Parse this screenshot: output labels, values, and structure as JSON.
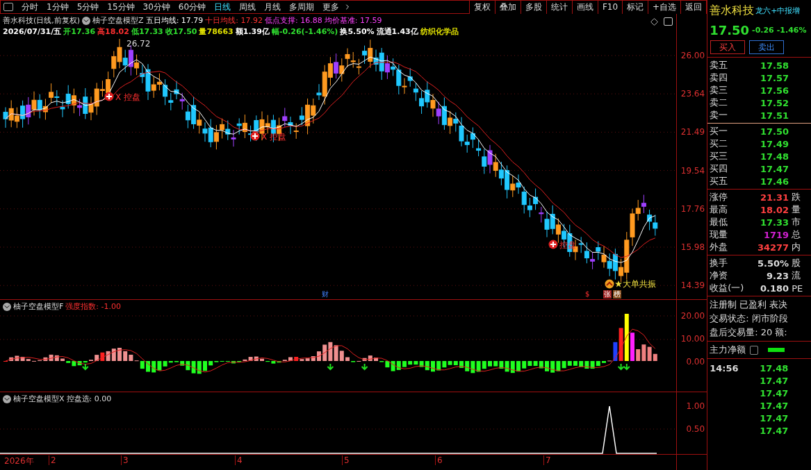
{
  "toolbar": {
    "periods": [
      {
        "label": "分时",
        "selected": false
      },
      {
        "label": "1分钟",
        "selected": false
      },
      {
        "label": "5分钟",
        "selected": false
      },
      {
        "label": "15分钟",
        "selected": false
      },
      {
        "label": "30分钟",
        "selected": false
      },
      {
        "label": "60分钟",
        "selected": false
      },
      {
        "label": "日线",
        "selected": true
      },
      {
        "label": "周线",
        "selected": false
      },
      {
        "label": "月线",
        "selected": false
      },
      {
        "label": "多周期",
        "selected": false
      },
      {
        "label": "更多",
        "selected": false
      }
    ],
    "actions": [
      "复权",
      "叠加",
      "多股",
      "统计",
      "画线",
      "F10",
      "标记",
      "+自选",
      "返回"
    ]
  },
  "main_chart": {
    "title": "善水科技(日线,前复权)",
    "indicator": "柚子空盘模型Z",
    "legend": [
      {
        "text": "五日均线: 17.79",
        "color": "#ffffff"
      },
      {
        "text": "十日均线: 17.92",
        "color": "#ff3030"
      },
      {
        "text": "低点支撑: 16.88",
        "color": "#ff40ff"
      },
      {
        "text": "均价基准: 17.59",
        "color": "#ff40ff"
      }
    ],
    "quote": [
      {
        "text": "2026/07/31/五",
        "color": "#ffffff"
      },
      {
        "text": "开17.36",
        "color": "#30e030"
      },
      {
        "text": "高18.02",
        "color": "#ff3030"
      },
      {
        "text": "低17.33",
        "color": "#30e030"
      },
      {
        "text": "收17.50",
        "color": "#30e030"
      },
      {
        "text": "量78663",
        "color": "#e0e000"
      },
      {
        "text": "额1.39亿",
        "color": "#ffffff"
      },
      {
        "text": "幅-0.26(-1.46%)",
        "color": "#30e030"
      },
      {
        "text": "换5.50%",
        "color": "#ffffff"
      },
      {
        "text": "流通1.43亿",
        "color": "#ffffff"
      },
      {
        "text": "纺织化学品",
        "color": "#e0e000"
      }
    ],
    "price_axis": [
      "26.00",
      "23.64",
      "21.49",
      "19.54",
      "17.76",
      "15.98",
      "14.39"
    ],
    "peak_label": "26.72",
    "markers": [
      {
        "kind": "control",
        "text": "X 控盘"
      },
      {
        "kind": "control",
        "text": "X 控盘"
      },
      {
        "kind": "control",
        "text": "控盘"
      }
    ],
    "signal": "大单共振",
    "badges": [
      {
        "kind": "finance",
        "text": "财"
      },
      {
        "kind": "dollar",
        "text": "$"
      },
      {
        "kind": "limit",
        "text": "张"
      },
      {
        "kind": "list",
        "text": "榜"
      }
    ]
  },
  "sub_chart_1": {
    "indicator": "柚子空盘模型F",
    "reading": "强度指数: -1.00",
    "axis": [
      "20.00",
      "10.00",
      "0.00"
    ]
  },
  "sub_chart_2": {
    "indicator": "柚子空盘模型X",
    "reading": "控盘选: 0.00",
    "axis": [
      "1.00",
      "0.50"
    ]
  },
  "time_axis": [
    "2026年",
    "2",
    "3",
    "4",
    "5",
    "6",
    "7"
  ],
  "quote_panel": {
    "name": "善水科技",
    "tags": "龙六+中报增",
    "price": "17.50",
    "change": "-0.26",
    "change_pct": "-1.46%",
    "buttons": [
      {
        "label": "买入",
        "kind": "buy"
      },
      {
        "label": "卖出",
        "kind": "sell"
      }
    ],
    "asks": [
      {
        "label": "卖五",
        "price": "17.58"
      },
      {
        "label": "卖四",
        "price": "17.57"
      },
      {
        "label": "卖三",
        "price": "17.56"
      },
      {
        "label": "卖二",
        "price": "17.52"
      },
      {
        "label": "卖一",
        "price": "17.51"
      }
    ],
    "bids": [
      {
        "label": "买一",
        "price": "17.50"
      },
      {
        "label": "买二",
        "price": "17.49"
      },
      {
        "label": "买三",
        "price": "17.48"
      },
      {
        "label": "买四",
        "price": "17.47"
      },
      {
        "label": "买五",
        "price": "17.46"
      }
    ],
    "stats": [
      {
        "label": "涨停",
        "value": "21.31",
        "color": "#ff4040",
        "extra": "跌"
      },
      {
        "label": "最高",
        "value": "18.02",
        "color": "#ff4040",
        "extra": "量"
      },
      {
        "label": "最低",
        "value": "17.33",
        "color": "#30e030",
        "extra": "市"
      },
      {
        "label": "现量",
        "value": "1719",
        "color": "#d020d0",
        "extra": "总"
      },
      {
        "label": "外盘",
        "value": "34277",
        "color": "#ff4040",
        "extra": "内"
      }
    ],
    "fundamentals": [
      {
        "label": "换手",
        "value": "5.50%",
        "extra": "股"
      },
      {
        "label": "净资",
        "value": "9.23",
        "extra": "流"
      },
      {
        "label": "收益(一)",
        "value": "0.180",
        "extra": "PE"
      }
    ],
    "notes": [
      "注册制 已盈利 表决",
      "交易状态: 闭市阶段",
      "盘后交易量: 20  额:"
    ],
    "net_flow": "主力净额",
    "ticks": [
      {
        "time": "14:56",
        "price": "17.48"
      },
      {
        "price": "17.47"
      },
      {
        "price": "17.47"
      },
      {
        "price": "17.47"
      },
      {
        "price": "17.47"
      },
      {
        "price": "17.47"
      }
    ]
  }
}
